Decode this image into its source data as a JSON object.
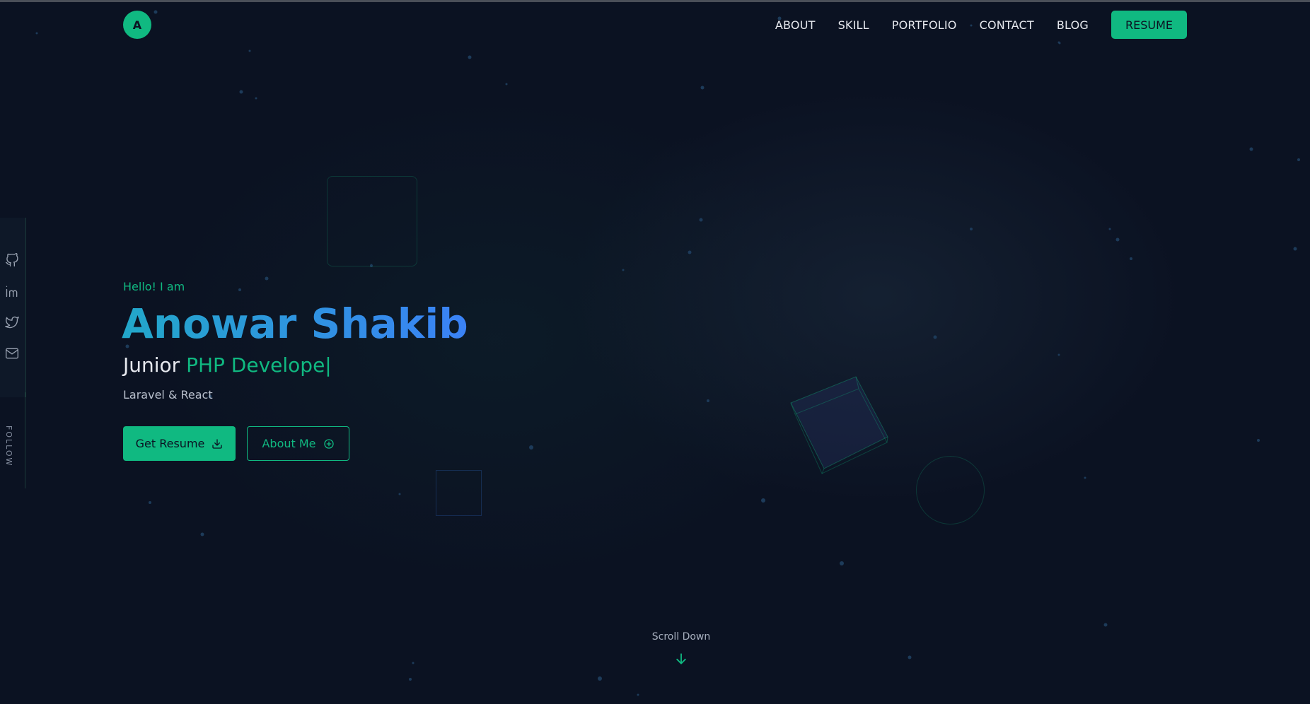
{
  "logo": {
    "letter": "A"
  },
  "nav": {
    "links": [
      "ABOUT",
      "SKILL",
      "PORTFOLIO",
      "CONTACT",
      "BLOG"
    ],
    "resume_label": "RESUME"
  },
  "social": {
    "icons": [
      "github-icon",
      "linkedin-icon",
      "twitter-icon",
      "mail-icon"
    ],
    "follow_label": "FOLLOW"
  },
  "hero": {
    "greeting": "Hello! I am",
    "name": "Anowar Shakib",
    "role_prefix": "Junior",
    "role_typed": "PHP Develope",
    "cursor": "|",
    "stack": "Laravel & React",
    "primary_button": "Get Resume",
    "secondary_button": "About Me"
  },
  "scroll": {
    "label": "Scroll Down"
  },
  "colors": {
    "background": "#0b1222",
    "accent": "#10b981",
    "name_gradient_start": "#22a7c9",
    "name_gradient_end": "#3b82f6"
  }
}
